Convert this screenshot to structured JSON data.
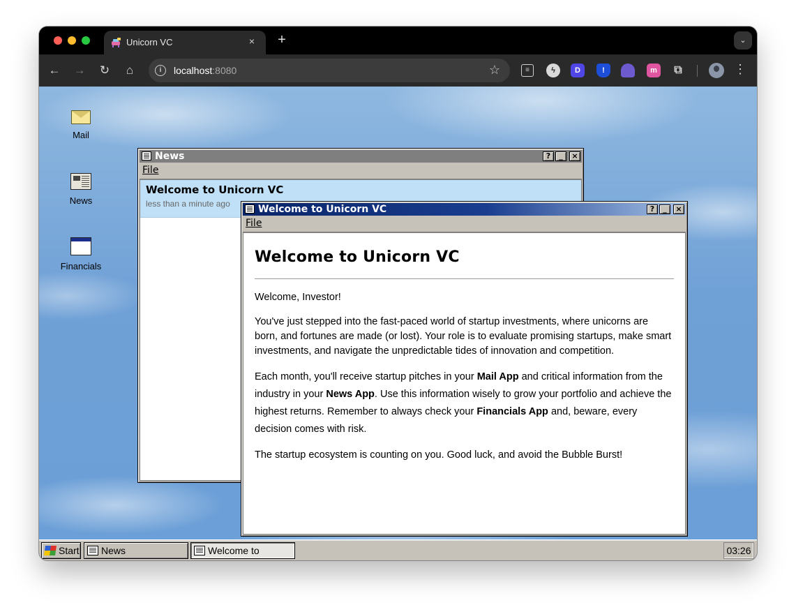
{
  "browser": {
    "tab_title": "Unicorn VC",
    "tab_close": "×",
    "new_tab": "+",
    "url_host": "localhost",
    "url_port": ":8080"
  },
  "desktop": {
    "icons": [
      {
        "label": "Mail",
        "icon": "envelope-icon"
      },
      {
        "label": "News",
        "icon": "newspaper-icon"
      },
      {
        "label": "Financials",
        "icon": "window-icon"
      }
    ]
  },
  "news_window": {
    "title": "News",
    "menu_file_u": "F",
    "menu_file_rest": "ile",
    "items": [
      {
        "title": "Welcome to Unicorn VC",
        "time": "less than a minute ago"
      }
    ]
  },
  "welcome_window": {
    "title": "Welcome to Unicorn VC",
    "menu_file_u": "F",
    "menu_file_rest": "ile",
    "heading": "Welcome to Unicorn VC",
    "greeting": "Welcome, Investor!",
    "p2": "You've just stepped into the fast-paced world of startup investments, where unicorns are born, and fortunes are made (or lost). Your role is to evaluate promising startups, make smart investments, and navigate the unpredictable tides of innovation and competition.",
    "p3_a": "Each month, you'll receive startup pitches in your ",
    "p3_mail": "Mail App",
    "p3_b": " and critical information from the industry in your ",
    "p3_news": "News App",
    "p3_c": ". Use this information wisely to grow your portfolio and achieve the highest returns. Remember to always check your ",
    "p3_fin": "Financials App",
    "p3_d": " and, beware, every decision comes with risk.",
    "p4": "The startup ecosystem is counting on you. Good luck, and avoid the Bubble Burst!"
  },
  "window_buttons": {
    "help": "?",
    "minimize": "_",
    "close": "×"
  },
  "taskbar": {
    "start": "Start",
    "tasks": [
      "News",
      "Welcome to Unicor..."
    ],
    "clock": "03:26"
  }
}
